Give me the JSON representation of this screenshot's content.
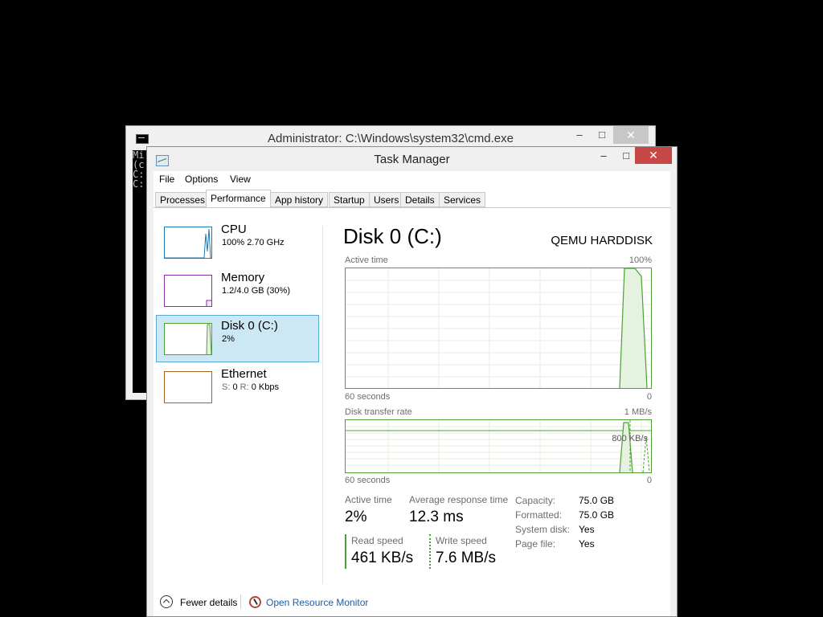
{
  "cmd_window": {
    "title": "Administrator: C:\\Windows\\system32\\cmd.exe",
    "min": "–",
    "max": "□",
    "close": "✕",
    "console_lines": [
      "Mi",
      "(c",
      "",
      "C:",
      "",
      "C:"
    ]
  },
  "task_manager": {
    "title": "Task Manager",
    "min": "–",
    "max": "□",
    "close": "✕",
    "menu": [
      "File",
      "Options",
      "View"
    ],
    "tabs": [
      "Processes",
      "Performance",
      "App history",
      "Startup",
      "Users",
      "Details",
      "Services"
    ],
    "active_tab": "Performance"
  },
  "perf_list": [
    {
      "name": "CPU",
      "sub": "100%  2.70 GHz",
      "color": "#1a79b4"
    },
    {
      "name": "Memory",
      "sub": "1.2/4.0 GB (30%)",
      "color": "#8a2ca3"
    },
    {
      "name": "Disk 0 (C:)",
      "sub": "2%",
      "color": "#4da033"
    },
    {
      "name": "Ethernet",
      "sub_s": "S: ",
      "sub_s_val": "0 ",
      "sub_r": "R: ",
      "sub_r_val": "0 Kbps",
      "color": "#a6651e"
    }
  ],
  "detail": {
    "title": "Disk 0 (C:)",
    "model": "QEMU HARDDISK",
    "graph1": {
      "label": "Active time",
      "max": "100%",
      "time": "60 seconds",
      "min": "0"
    },
    "graph2": {
      "label": "Disk transfer rate",
      "max": "1 MB/s",
      "mark": "800 KB/s",
      "time": "60 seconds",
      "min": "0"
    },
    "stats": {
      "active_time_label": "Active time",
      "active_time_value": "2%",
      "avg_response_label": "Average response time",
      "avg_response_value": "12.3 ms",
      "read_label": "Read speed",
      "read_value": "461 KB/s",
      "write_label": "Write speed",
      "write_value": "7.6 MB/s"
    },
    "props": [
      {
        "label": "Capacity:",
        "value": "75.0 GB"
      },
      {
        "label": "Formatted:",
        "value": "75.0 GB"
      },
      {
        "label": "System disk:",
        "value": "Yes"
      },
      {
        "label": "Page file:",
        "value": "Yes"
      }
    ]
  },
  "footer": {
    "fewer_details": "Fewer details",
    "resource_monitor": "Open Resource Monitor"
  },
  "colors": {
    "disk_green": "#4da033",
    "link_blue": "#1a5fa8",
    "selected_bg": "#cce8f4"
  }
}
